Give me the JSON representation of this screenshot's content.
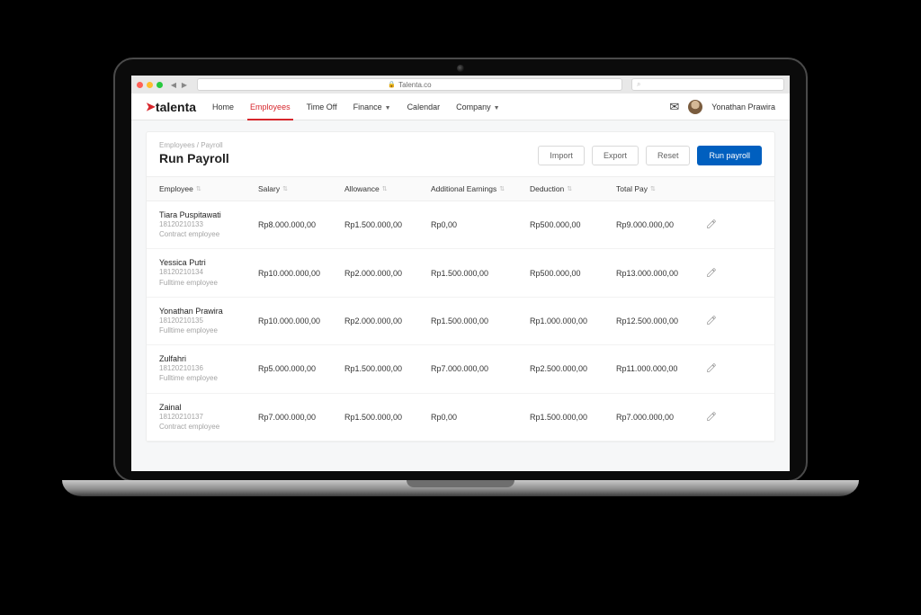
{
  "browser": {
    "url_display": "Talenta.co"
  },
  "header": {
    "logo_text": "talenta",
    "nav": [
      {
        "label": "Home",
        "active": false,
        "caret": false
      },
      {
        "label": "Employees",
        "active": true,
        "caret": false
      },
      {
        "label": "Time Off",
        "active": false,
        "caret": false
      },
      {
        "label": "Finance",
        "active": false,
        "caret": true
      },
      {
        "label": "Calendar",
        "active": false,
        "caret": false
      },
      {
        "label": "Company",
        "active": false,
        "caret": true
      }
    ],
    "user_name": "Yonathan Prawira"
  },
  "page": {
    "breadcrumb": "Employees / Payroll",
    "title": "Run Payroll",
    "actions": {
      "import": "Import",
      "export": "Export",
      "reset": "Reset",
      "run": "Run payroll"
    },
    "columns": [
      "Employee",
      "Salary",
      "Allowance",
      "Additional Earnings",
      "Deduction",
      "Total Pay"
    ],
    "rows": [
      {
        "name": "Tiara Puspitawati",
        "id": "18120210133",
        "type": "Contract employee",
        "salary": "Rp8.000.000,00",
        "allowance": "Rp1.500.000,00",
        "additional": "Rp0,00",
        "deduction": "Rp500.000,00",
        "total": "Rp9.000.000,00"
      },
      {
        "name": "Yessica Putri",
        "id": "18120210134",
        "type": "Fulltime employee",
        "salary": "Rp10.000.000,00",
        "allowance": "Rp2.000.000,00",
        "additional": "Rp1.500.000,00",
        "deduction": "Rp500.000,00",
        "total": "Rp13.000.000,00"
      },
      {
        "name": "Yonathan Prawira",
        "id": "18120210135",
        "type": "Fulltime employee",
        "salary": "Rp10.000.000,00",
        "allowance": "Rp2.000.000,00",
        "additional": "Rp1.500.000,00",
        "deduction": "Rp1.000.000,00",
        "total": "Rp12.500.000,00"
      },
      {
        "name": "Zulfahri",
        "id": "18120210136",
        "type": "Fulltime employee",
        "salary": "Rp5.000.000,00",
        "allowance": "Rp1.500.000,00",
        "additional": "Rp7.000.000,00",
        "deduction": "Rp2.500.000,00",
        "total": "Rp11.000.000,00"
      },
      {
        "name": "Zainal",
        "id": "18120210137",
        "type": "Contract employee",
        "salary": "Rp7.000.000,00",
        "allowance": "Rp1.500.000,00",
        "additional": "Rp0,00",
        "deduction": "Rp1.500.000,00",
        "total": "Rp7.000.000,00"
      }
    ]
  }
}
